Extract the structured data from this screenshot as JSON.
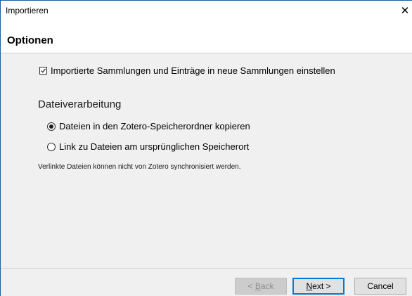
{
  "window": {
    "title": "Importieren",
    "close_glyph": "✕"
  },
  "header": {
    "title": "Optionen"
  },
  "options": {
    "checkbox_label": "Importierte Sammlungen und Einträge in neue Sammlungen einstellen",
    "checkbox_checked": true,
    "file_handling_label": "Dateiverarbeitung",
    "radio_copy_label": "Dateien in den Zotero-Speicherordner kopieren",
    "radio_copy_checked": true,
    "radio_link_label": "Link zu Dateien am ursprünglichen Speicherort",
    "radio_link_checked": false,
    "note": "Verlinkte Dateien können nicht von Zotero synchronisiert werden."
  },
  "buttons": {
    "back_prefix": "< ",
    "back_mnemonic": "B",
    "back_rest": "ack",
    "next_mnemonic": "N",
    "next_rest": "ext >",
    "cancel": "Cancel"
  },
  "colors": {
    "accent": "#0078d7",
    "window_border": "#1e5c9a",
    "background": "#f0f0f0"
  }
}
